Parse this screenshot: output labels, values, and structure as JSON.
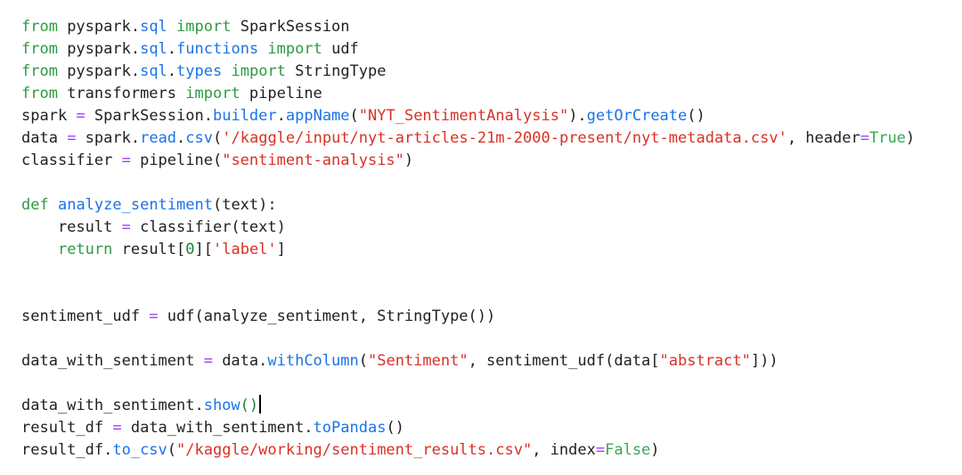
{
  "colors": {
    "default": "#212121",
    "keyword": "#2e9a43",
    "attribute": "#1a73e8",
    "string": "#d93025",
    "operator": "#a142f4",
    "constant": "#34a853",
    "bracket_match": "#188038",
    "number": "#188038"
  },
  "code_lines": [
    [
      [
        "kw",
        "from"
      ],
      [
        "d",
        " pyspark."
      ],
      [
        "attr",
        "sql"
      ],
      [
        "d",
        " "
      ],
      [
        "kw",
        "import"
      ],
      [
        "d",
        " SparkSession"
      ]
    ],
    [
      [
        "kw",
        "from"
      ],
      [
        "d",
        " pyspark."
      ],
      [
        "attr",
        "sql"
      ],
      [
        "d",
        "."
      ],
      [
        "attr",
        "functions"
      ],
      [
        "d",
        " "
      ],
      [
        "kw",
        "import"
      ],
      [
        "d",
        " udf"
      ]
    ],
    [
      [
        "kw",
        "from"
      ],
      [
        "d",
        " pyspark."
      ],
      [
        "attr",
        "sql"
      ],
      [
        "d",
        "."
      ],
      [
        "attr",
        "types"
      ],
      [
        "d",
        " "
      ],
      [
        "kw",
        "import"
      ],
      [
        "d",
        " StringType"
      ]
    ],
    [
      [
        "kw",
        "from"
      ],
      [
        "d",
        " transformers "
      ],
      [
        "kw",
        "import"
      ],
      [
        "d",
        " pipeline"
      ]
    ],
    [
      [
        "d",
        "spark "
      ],
      [
        "op",
        "="
      ],
      [
        "d",
        " SparkSession."
      ],
      [
        "attr",
        "builder"
      ],
      [
        "d",
        "."
      ],
      [
        "attr",
        "appName"
      ],
      [
        "d",
        "("
      ],
      [
        "str",
        "\"NYT_SentimentAnalysis\""
      ],
      [
        "d",
        ")."
      ],
      [
        "attr",
        "getOrCreate"
      ],
      [
        "d",
        "()"
      ]
    ],
    [
      [
        "d",
        "data "
      ],
      [
        "op",
        "="
      ],
      [
        "d",
        " spark."
      ],
      [
        "attr",
        "read"
      ],
      [
        "d",
        "."
      ],
      [
        "attr",
        "csv"
      ],
      [
        "d",
        "("
      ],
      [
        "str",
        "'/kaggle/input/nyt-articles-21m-2000-present/nyt-metadata.csv'"
      ],
      [
        "d",
        ", header"
      ],
      [
        "op",
        "="
      ],
      [
        "const",
        "True"
      ],
      [
        "d",
        ")"
      ]
    ],
    [
      [
        "d",
        "classifier "
      ],
      [
        "op",
        "="
      ],
      [
        "d",
        " pipeline("
      ],
      [
        "str",
        "\"sentiment-analysis\""
      ],
      [
        "d",
        ")"
      ]
    ],
    [],
    [
      [
        "kw",
        "def"
      ],
      [
        "d",
        " "
      ],
      [
        "attr",
        "analyze_sentiment"
      ],
      [
        "d",
        "(text):"
      ]
    ],
    [
      [
        "d",
        "    result "
      ],
      [
        "op",
        "="
      ],
      [
        "d",
        " classifier(text)"
      ]
    ],
    [
      [
        "d",
        "    "
      ],
      [
        "kw",
        "return"
      ],
      [
        "d",
        " result["
      ],
      [
        "num",
        "0"
      ],
      [
        "d",
        "]["
      ],
      [
        "str",
        "'label'"
      ],
      [
        "d",
        "]"
      ]
    ],
    [],
    [],
    [
      [
        "d",
        "sentiment_udf "
      ],
      [
        "op",
        "="
      ],
      [
        "d",
        " udf(analyze_sentiment, StringType())"
      ]
    ],
    [],
    [
      [
        "d",
        "data_with_sentiment "
      ],
      [
        "op",
        "="
      ],
      [
        "d",
        " data."
      ],
      [
        "attr",
        "withColumn"
      ],
      [
        "d",
        "("
      ],
      [
        "str",
        "\"Sentiment\""
      ],
      [
        "d",
        ", sentiment_udf(data["
      ],
      [
        "str",
        "\"abstract\""
      ],
      [
        "d",
        "]))"
      ]
    ],
    [],
    [
      [
        "d",
        "data_with_sentiment."
      ],
      [
        "attr",
        "show"
      ],
      [
        "match",
        "()"
      ],
      [
        "cursor",
        ""
      ]
    ],
    [
      [
        "d",
        "result_df "
      ],
      [
        "op",
        "="
      ],
      [
        "d",
        " data_with_sentiment."
      ],
      [
        "attr",
        "toPandas"
      ],
      [
        "d",
        "()"
      ]
    ],
    [
      [
        "d",
        "result_df."
      ],
      [
        "attr",
        "to_csv"
      ],
      [
        "d",
        "("
      ],
      [
        "str",
        "\"/kaggle/working/sentiment_results.csv\""
      ],
      [
        "d",
        ", index"
      ],
      [
        "op",
        "="
      ],
      [
        "const",
        "False"
      ],
      [
        "d",
        ")"
      ]
    ]
  ]
}
